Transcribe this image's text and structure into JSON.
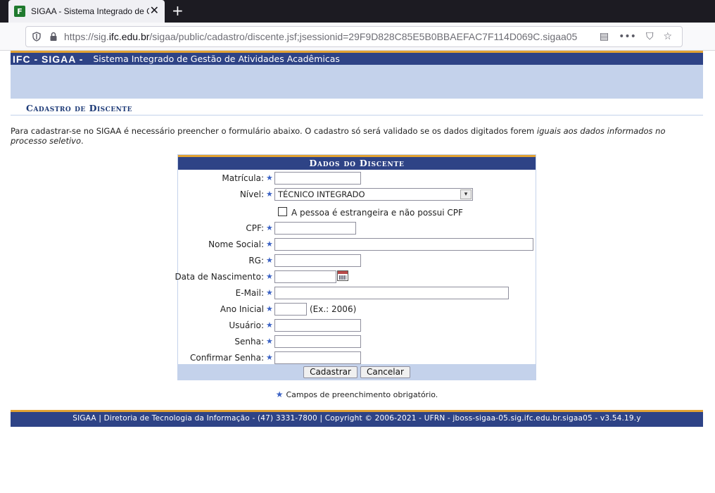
{
  "browser": {
    "tab_title": "SIGAA - Sistema Integrado de Gestão de Atividades Acadêmicas",
    "favicon_letter": "F",
    "url_prefix": "https://sig.",
    "url_domain": "ifc.edu.br",
    "url_path": "/sigaa/public/cadastro/discente.jsf;jsessionid=29F9D828C85E5B0BBAEFAC7F114D069C.sigaa05"
  },
  "header": {
    "brand": "IFC - SIGAA -",
    "subtitle": "Sistema Integrado de Gestão de Atividades Acadêmicas"
  },
  "page": {
    "title": "Cadastro de Discente",
    "intro_plain": "Para cadastrar-se no SIGAA é necessário preencher o formulário abaixo. O cadastro só será validado se os dados digitados forem ",
    "intro_emphasis": "iguais aos dados informados no processo seletivo",
    "intro_end": "."
  },
  "form": {
    "caption": "Dados do Discente",
    "matricula_label": "Matrícula:",
    "nivel_label": "Nível:",
    "nivel_selected": "TÉCNICO INTEGRADO",
    "estrangeiro_label": "A pessoa é estrangeira e não possui CPF",
    "cpf_label": "CPF:",
    "nome_social_label": "Nome Social:",
    "rg_label": "RG:",
    "data_nascimento_label": "Data de Nascimento:",
    "email_label": "E-Mail:",
    "ano_inicial_label": "Ano Inicial",
    "ano_inicial_hint": "(Ex.: 2006)",
    "usuario_label": "Usuário:",
    "senha_label": "Senha:",
    "confirmar_senha_label": "Confirmar Senha:",
    "submit_label": "Cadastrar",
    "cancel_label": "Cancelar",
    "required_star": "★",
    "required_note": "Campos de preenchimento obrigatório."
  },
  "footer": {
    "text": "SIGAA | Diretoria de Tecnologia da Informação - (47) 3331-7800 | Copyright © 2006-2021 - UFRN - jboss-sigaa-05.sig.ifc.edu.br.sigaa05 - v3.54.19.y"
  },
  "colors": {
    "header_blue": "#2e4386",
    "accent_orange": "#e2a232",
    "light_blue": "#c4d2eb",
    "title_blue": "#1d3a77"
  }
}
